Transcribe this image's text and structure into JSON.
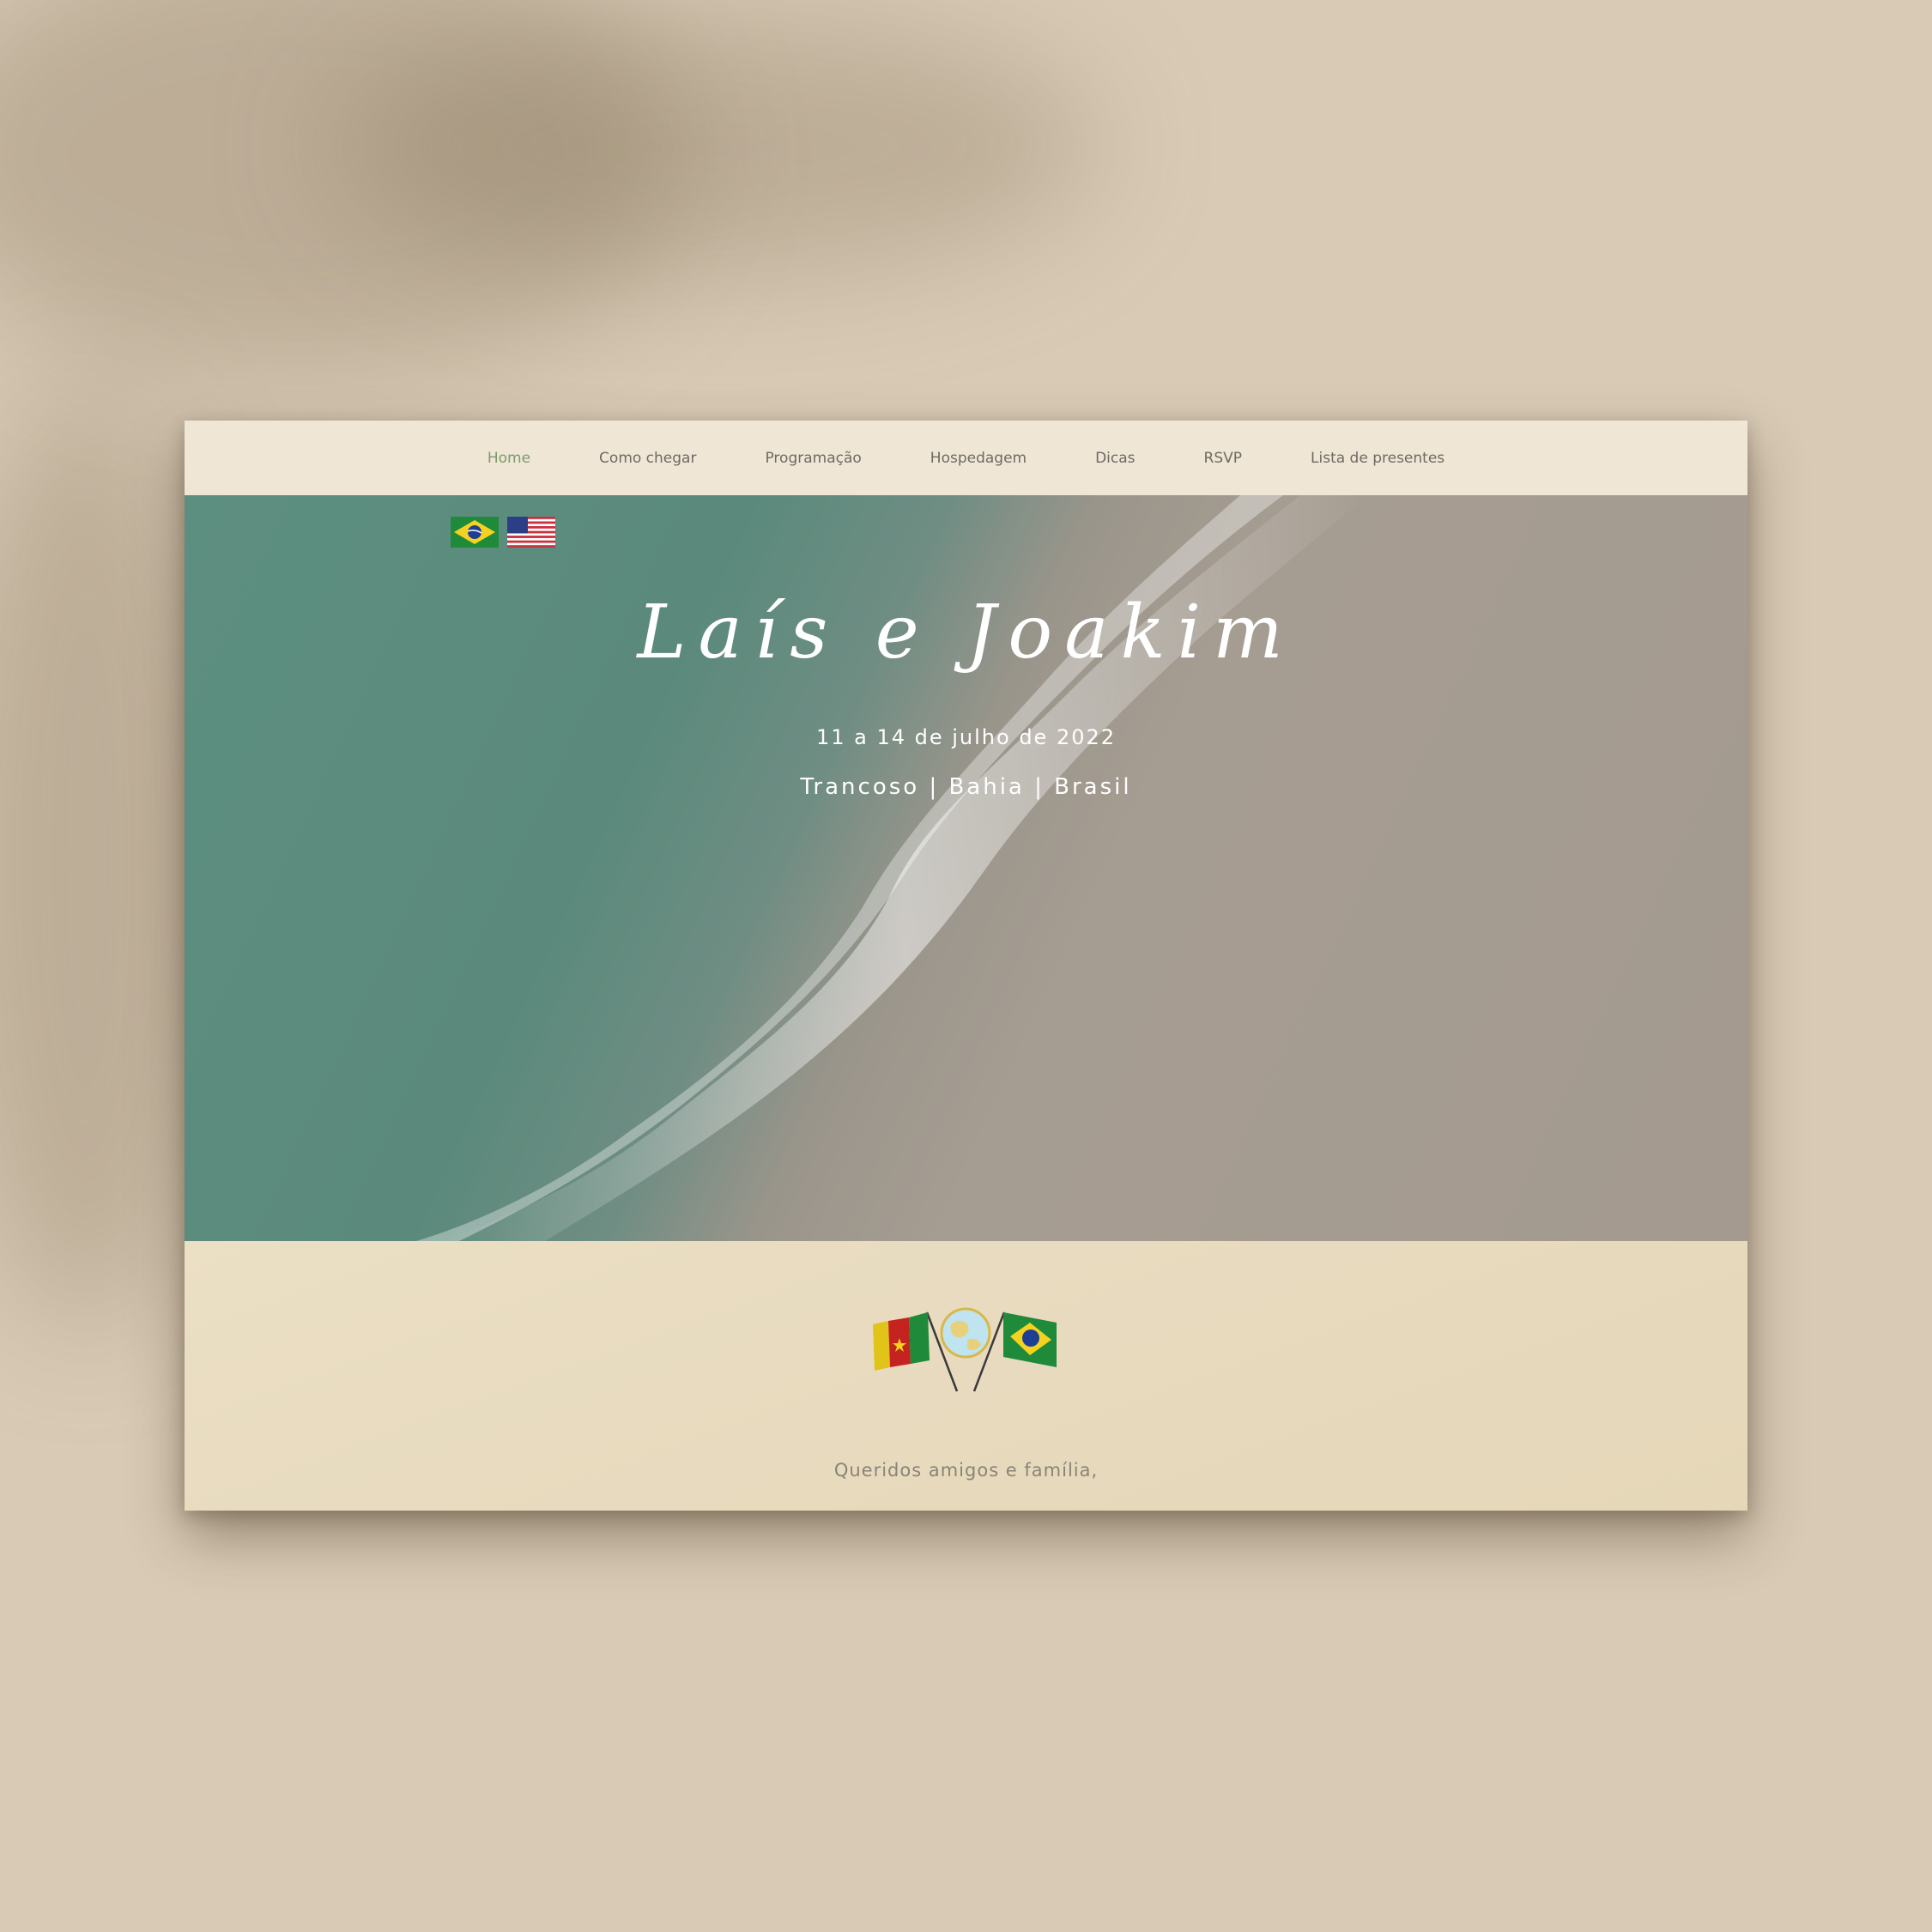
{
  "nav": {
    "items": [
      {
        "label": "Home",
        "active": true
      },
      {
        "label": "Como chegar",
        "active": false
      },
      {
        "label": "Programação",
        "active": false
      },
      {
        "label": "Hospedagem",
        "active": false
      },
      {
        "label": "Dicas",
        "active": false
      },
      {
        "label": "RSVP",
        "active": false
      },
      {
        "label": "Lista de presentes",
        "active": false
      }
    ]
  },
  "languages": [
    {
      "name": "brazil-flag-icon"
    },
    {
      "name": "usa-flag-icon"
    }
  ],
  "hero": {
    "couple": "Laís e Joakim",
    "dates": "11 a 14 de julho de 2022",
    "location": "Trancoso | Bahia | Brasil"
  },
  "intro": {
    "emblem": "cameroon-brazil-flags-globe-icon",
    "greeting": "Queridos amigos e família,"
  },
  "colors": {
    "background": "#d8cab5",
    "navbar": "#efe6d6",
    "nav_active": "#7c9b6c",
    "nav_text": "#6e6a63",
    "sand": "#e8dbbf",
    "sea": "#5d8f80"
  }
}
